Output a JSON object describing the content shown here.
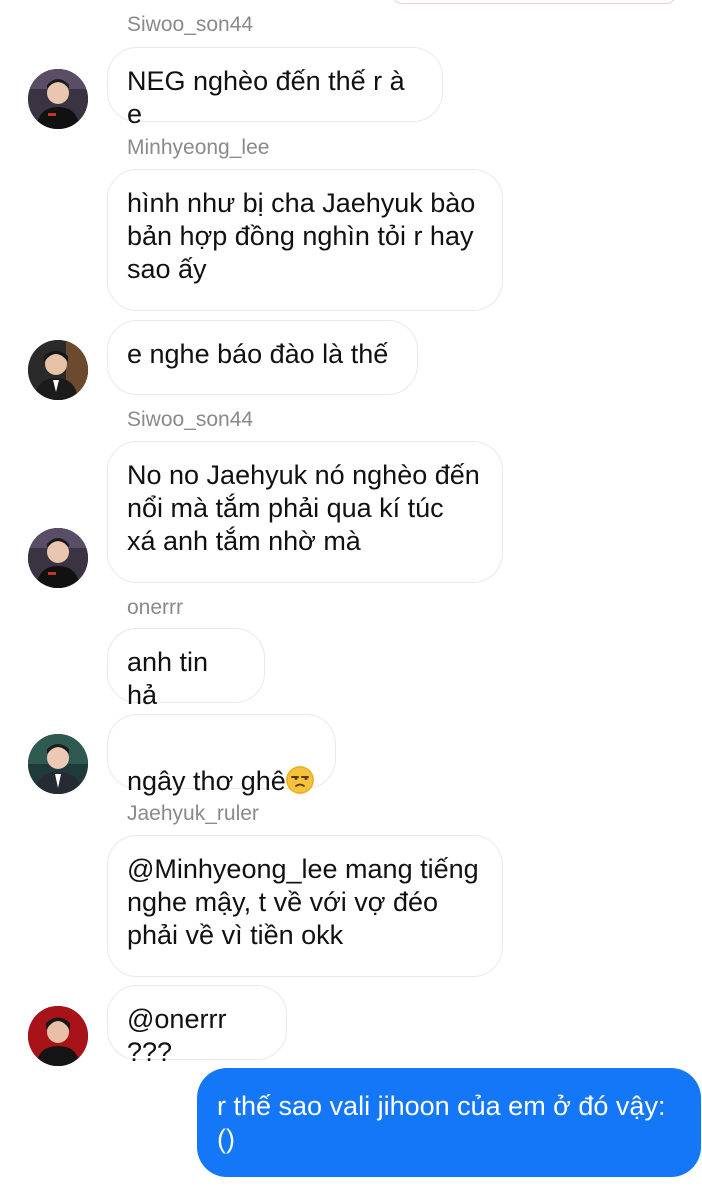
{
  "messages": [
    {
      "sender": "Siwoo_son44",
      "text": "NEG nghèo đến thế r à e",
      "avatar": "player-avatar-dark-jersey"
    },
    {
      "sender": "Minhyeong_lee",
      "text": "hình như bị cha Jaehyuk bào\nbản hợp đồng nghìn tỏi r hay\nsao ấy"
    },
    {
      "text": "e nghe báo đào là thế",
      "avatar": "player-avatar-suit"
    },
    {
      "sender": "Siwoo_son44",
      "text": "No no Jaehyuk nó nghèo đến\nnổi mà tắm phải qua kí túc\nxá anh tắm nhờ mà",
      "avatar": "player-avatar-dark-jersey"
    },
    {
      "sender": "onerrr",
      "text": "anh tin hả"
    },
    {
      "text": "ngây thơ ghê",
      "emoji": "unamused-face",
      "avatar": "player-avatar-suit-green"
    },
    {
      "sender": "Jaehyuk_ruler",
      "text": "@Minhyeong_lee mang tiếng\nnghe mậy, t về với vợ đéo\nphải về vì tiền okk"
    },
    {
      "text": "@onerrr ???",
      "avatar": "player-avatar-red"
    },
    {
      "text": "r thế sao vali jihoon của em ở đó vậy:\n()",
      "mine": true
    }
  ],
  "colors": {
    "my_bubble": "#1477f8",
    "other_bubble_border": "#e9e9e9",
    "sender_name": "#8a8a8a"
  }
}
